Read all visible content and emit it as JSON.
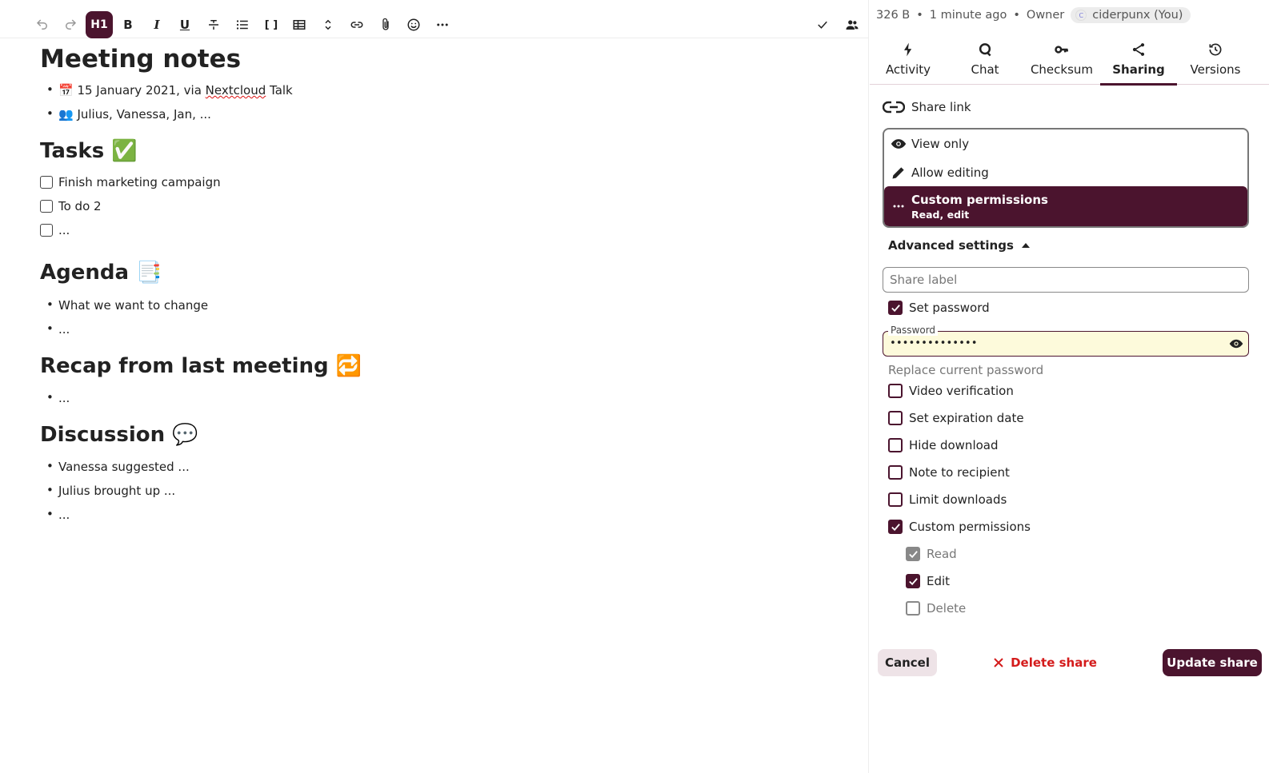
{
  "toolbar": {
    "heading_label": "H1"
  },
  "doc": {
    "title": "Meeting notes",
    "info_items": [
      {
        "icon": "📅",
        "pre": " 15 January 2021, via ",
        "link": "Nextcloud",
        "post": " Talk"
      },
      {
        "icon": "👥",
        "pre": " Julius, Vanessa, Jan, ...",
        "link": "",
        "post": ""
      }
    ],
    "tasks_heading": "Tasks ✅",
    "tasks": [
      "Finish marketing campaign",
      "To do 2",
      "..."
    ],
    "agenda_heading": "Agenda 📑",
    "agenda_items": [
      "What we want to change",
      "..."
    ],
    "recap_heading": "Recap from last meeting 🔁",
    "recap_items": [
      "..."
    ],
    "discussion_heading": "Discussion 💬",
    "discussion_items": [
      "Vanessa suggested ...",
      "Julius brought up ...",
      "..."
    ]
  },
  "sidebar": {
    "meta": {
      "size": "326 B",
      "modified": "1 minute ago",
      "role": "Owner",
      "owner_initial": "C",
      "owner": "ciderpunx (You)"
    },
    "tabs": [
      {
        "label": "Activity",
        "icon": "lightning-icon"
      },
      {
        "label": "Chat",
        "icon": "chat-icon"
      },
      {
        "label": "Checksum",
        "icon": "key-icon"
      },
      {
        "label": "Sharing",
        "icon": "share-icon",
        "active": true
      },
      {
        "label": "Versions",
        "icon": "history-icon"
      }
    ],
    "share_link": "Share link",
    "permissions": {
      "view_only": "View only",
      "allow_editing": "Allow editing",
      "custom": "Custom permissions",
      "custom_detail": "Read, edit"
    },
    "advanced_settings": "Advanced settings",
    "share_label_placeholder": "Share label",
    "set_password": "Set password",
    "password_label": "Password",
    "password_value": "••••••••••••••",
    "replace_password": "Replace current password",
    "options": {
      "video_verification": "Video verification",
      "expiration": "Set expiration date",
      "hide_download": "Hide download",
      "note": "Note to recipient",
      "limit_downloads": "Limit downloads",
      "custom_permissions": "Custom permissions",
      "read": "Read",
      "edit": "Edit",
      "delete": "Delete"
    },
    "buttons": {
      "cancel": "Cancel",
      "delete_share": "Delete share",
      "update_share": "Update share"
    },
    "colors": {
      "primary": "#4b142e",
      "danger": "#d41b1b",
      "password_bg": "#fdfadb"
    }
  }
}
